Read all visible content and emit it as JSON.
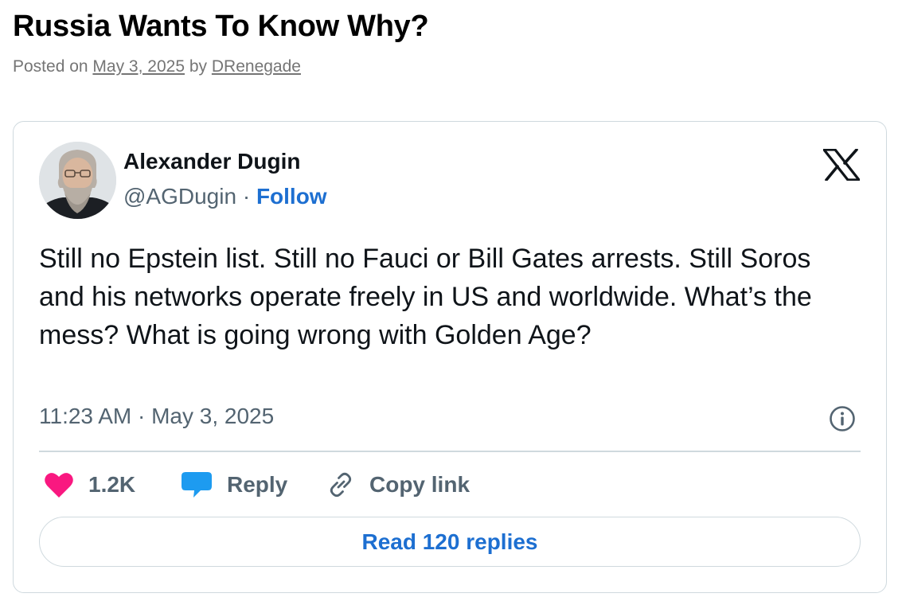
{
  "post": {
    "title": "Russia Wants To Know Why?",
    "posted_on_label": "Posted on",
    "date": "May 3, 2025",
    "by_label": "by",
    "author": "DRenegade"
  },
  "tweet": {
    "author_name": "Alexander Dugin",
    "handle": "@AGDugin",
    "separator": "·",
    "follow_label": "Follow",
    "text": "Still no Epstein list. Still no Fauci or Bill Gates arrests. Still Soros and his networks operate freely in US and worldwide. What’s the mess? What is going wrong with Golden Age?",
    "timestamp": "11:23 AM · May 3, 2025",
    "likes_count": "1.2K",
    "reply_label": "Reply",
    "copy_link_label": "Copy link",
    "read_replies_label": "Read 120 replies"
  },
  "icons": {
    "platform_logo": "x-logo-icon",
    "info": "info-icon",
    "like": "heart-icon",
    "reply": "speech-bubble-icon",
    "copy_link": "link-icon"
  },
  "colors": {
    "link_blue": "#1d6fd1",
    "like_pink": "#f91880",
    "reply_blue": "#1d9bf0",
    "muted_gray": "#536471",
    "meta_gray": "#757575",
    "border": "#cfd9de"
  }
}
